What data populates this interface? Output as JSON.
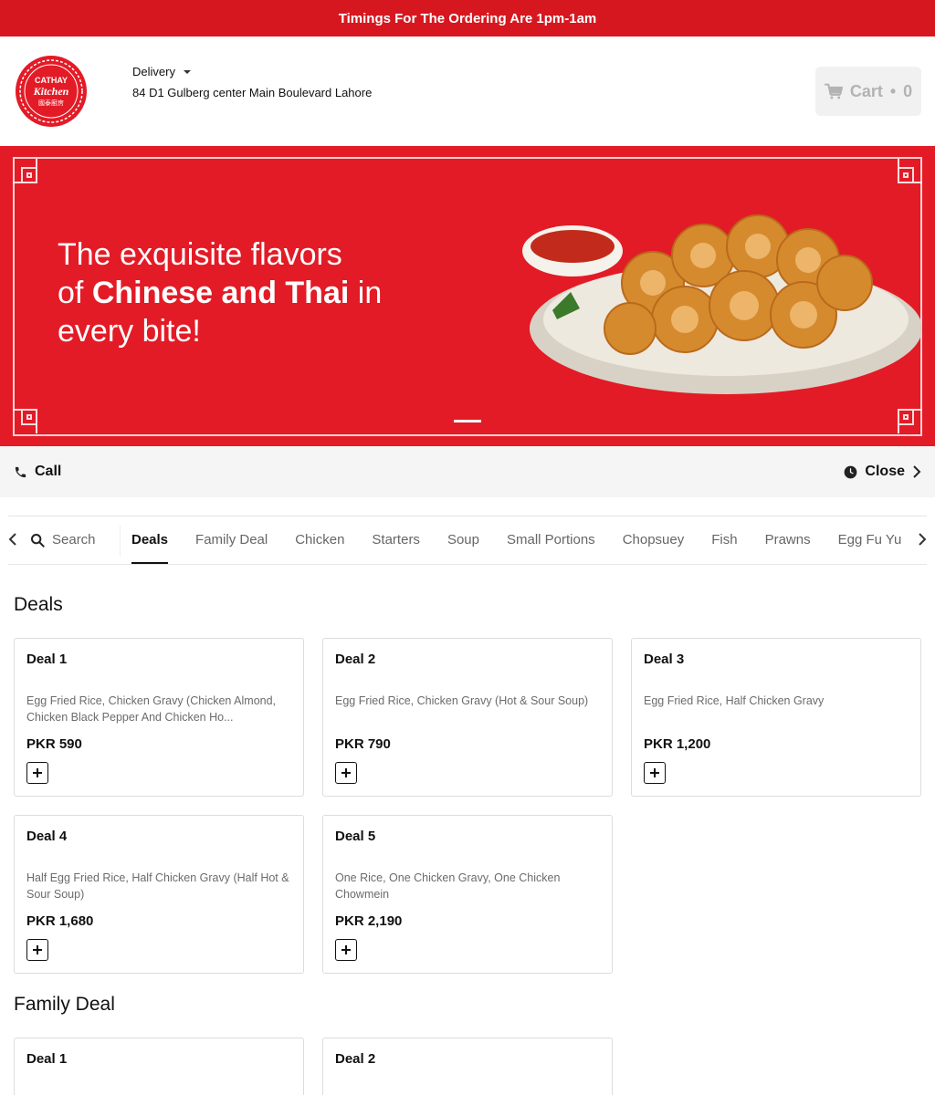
{
  "topbar": {
    "text": "Timings For The Ordering Are 1pm-1am"
  },
  "header": {
    "logo": {
      "line1": "CATHAY",
      "line2": "Kitchen",
      "line3": "國泰廚房"
    },
    "delivery_label": "Delivery",
    "address": "84 D1 Gulberg center Main Boulevard Lahore",
    "cart": {
      "label": "Cart",
      "separator": "•",
      "count": "0"
    }
  },
  "banner": {
    "line1": "The exquisite flavors",
    "line2_pre": "of ",
    "line2_bold": "Chinese and Thai",
    "line2_post": " in",
    "line3": "every bite!"
  },
  "info": {
    "call_label": "Call",
    "status_label": "Close"
  },
  "nav": {
    "search_label": "Search",
    "categories": [
      "Deals",
      "Family Deal",
      "Chicken",
      "Starters",
      "Soup",
      "Small Portions",
      "Chopsuey",
      "Fish",
      "Prawns",
      "Egg Fu Yu"
    ]
  },
  "sections": [
    {
      "title": "Deals",
      "items": [
        {
          "title": "Deal 1",
          "desc": "Egg Fried Rice, Chicken Gravy (Chicken Almond, Chicken Black Pepper And Chicken Ho...",
          "price": "PKR 590"
        },
        {
          "title": "Deal 2",
          "desc": "Egg Fried Rice, Chicken Gravy (Hot & Sour Soup)",
          "price": "PKR 790"
        },
        {
          "title": "Deal 3",
          "desc": "Egg Fried Rice, Half Chicken Gravy",
          "price": "PKR 1,200"
        },
        {
          "title": "Deal 4",
          "desc": "Half Egg Fried Rice, Half Chicken Gravy (Half Hot & Sour Soup)",
          "price": "PKR 1,680"
        },
        {
          "title": "Deal 5",
          "desc": "One Rice, One Chicken Gravy, One Chicken Chowmein",
          "price": "PKR 2,190"
        }
      ]
    },
    {
      "title": "Family Deal",
      "items": [
        {
          "title": "Deal 1"
        },
        {
          "title": "Deal 2"
        }
      ]
    }
  ],
  "colors": {
    "brand_red": "#d7171f"
  }
}
